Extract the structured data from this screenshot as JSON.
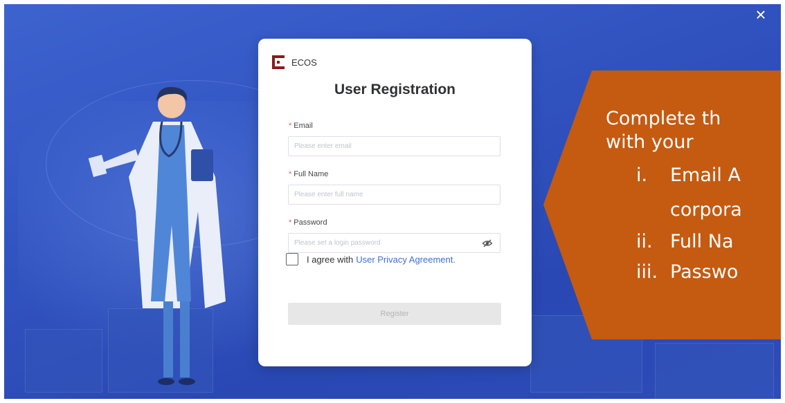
{
  "modal": {
    "brand": "ECOS",
    "title": "User Registration",
    "fields": [
      {
        "label": "Email",
        "placeholder": "Please enter email",
        "required": "*"
      },
      {
        "label": "Full Name",
        "placeholder": "Please enter full name",
        "required": "*"
      },
      {
        "label": "Password",
        "placeholder": "Please set a login password",
        "required": "*"
      }
    ],
    "agree_text": "I agree with",
    "agree_link": "User Privacy Agreement.",
    "register_label": "Register"
  },
  "close_glyph": "×",
  "callout": {
    "line1": "Complete th",
    "line2": "with your",
    "items": [
      {
        "num": "i.",
        "text": "Email A"
      },
      {
        "num": "",
        "text": "corpora"
      },
      {
        "num": "ii.",
        "text": "Full Na"
      },
      {
        "num": "iii.",
        "text": "Passwo"
      }
    ]
  },
  "colors": {
    "background": "#3255c2",
    "callout": "#c55a11",
    "link": "#3b6fd6",
    "logo": "#8b1a1a"
  },
  "icons": [
    "close-icon",
    "ecos-logo-icon",
    "eye-hidden-icon",
    "checkbox-icon"
  ]
}
